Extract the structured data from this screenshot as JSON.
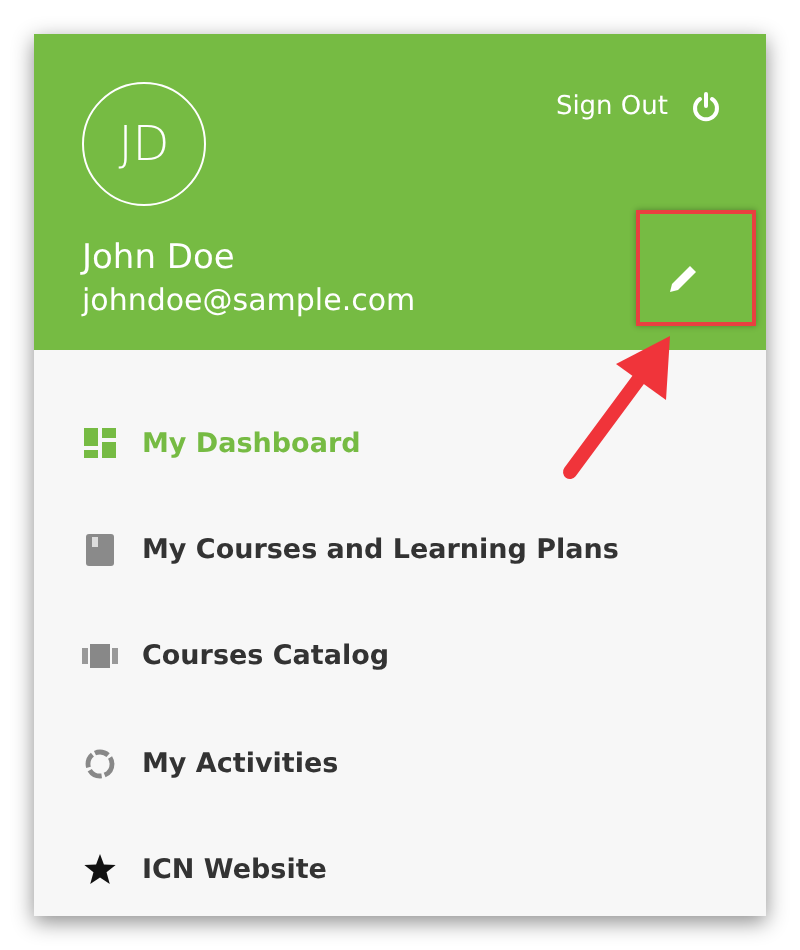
{
  "profile": {
    "initials": "JD",
    "name": "John Doe",
    "email": "johndoe@sample.com",
    "sign_out": "Sign Out"
  },
  "menu": [
    {
      "label": "My Dashboard",
      "kind": "dashboard",
      "selected": true
    },
    {
      "label": "My Courses and Learning Plans",
      "kind": "courses",
      "selected": false
    },
    {
      "label": "Courses Catalog",
      "kind": "catalog",
      "selected": false
    },
    {
      "label": "My Activities",
      "kind": "activities",
      "selected": false
    },
    {
      "label": "ICN Website",
      "kind": "website",
      "selected": false
    }
  ]
}
